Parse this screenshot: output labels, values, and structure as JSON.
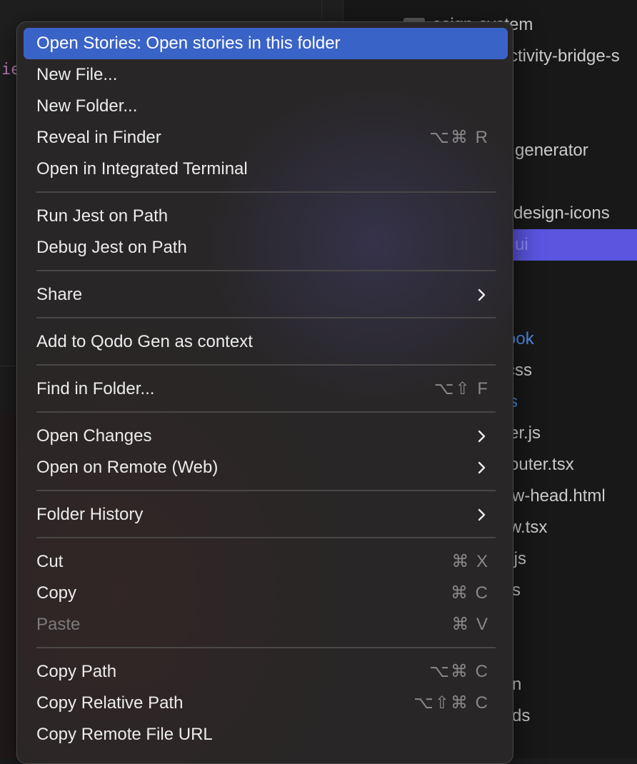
{
  "editor": {
    "code_fragment": "ie"
  },
  "explorer": {
    "rows": [
      {
        "text": "esign-system",
        "state": "normal"
      },
      {
        "text": "ctivity-bridge-s",
        "state": "normal"
      },
      {
        "text": "generator",
        "state": "normal"
      },
      {
        "text": "design-icons",
        "state": "normal"
      },
      {
        "text": "ui",
        "state": "selected"
      },
      {
        "text": "ook",
        "state": "link"
      },
      {
        "text": "css",
        "state": "normal"
      },
      {
        "text": "s",
        "state": "link"
      },
      {
        "text": "er.js",
        "state": "normal"
      },
      {
        "text": "outer.tsx",
        "state": "normal"
      },
      {
        "text": "w-head.html",
        "state": "normal"
      },
      {
        "text": "w.tsx",
        "state": "normal"
      },
      {
        "text": ".js",
        "state": "normal"
      },
      {
        "text": "s",
        "state": "normal"
      },
      {
        "text": "n",
        "state": "normal"
      },
      {
        "text": "ds",
        "state": "normal"
      }
    ]
  },
  "context_menu": {
    "items": [
      {
        "label": "Open Stories: Open stories in this folder",
        "shortcut": "",
        "submenu": false,
        "state": "highlighted"
      },
      {
        "label": "New File...",
        "shortcut": "",
        "submenu": false,
        "state": "normal"
      },
      {
        "label": "New Folder...",
        "shortcut": "",
        "submenu": false,
        "state": "normal"
      },
      {
        "label": "Reveal in Finder",
        "shortcut": "⌥⌘ R",
        "submenu": false,
        "state": "normal"
      },
      {
        "label": "Open in Integrated Terminal",
        "shortcut": "",
        "submenu": false,
        "state": "normal"
      },
      {
        "label": "Run Jest on Path",
        "shortcut": "",
        "submenu": false,
        "state": "normal"
      },
      {
        "label": "Debug Jest on Path",
        "shortcut": "",
        "submenu": false,
        "state": "normal"
      },
      {
        "label": "Share",
        "shortcut": "",
        "submenu": true,
        "state": "normal"
      },
      {
        "label": "Add to Qodo Gen as context",
        "shortcut": "",
        "submenu": false,
        "state": "normal"
      },
      {
        "label": "Find in Folder...",
        "shortcut": "⌥⇧ F",
        "submenu": false,
        "state": "normal"
      },
      {
        "label": "Open Changes",
        "shortcut": "",
        "submenu": true,
        "state": "normal"
      },
      {
        "label": "Open on Remote (Web)",
        "shortcut": "",
        "submenu": true,
        "state": "normal"
      },
      {
        "label": "Folder History",
        "shortcut": "",
        "submenu": true,
        "state": "normal"
      },
      {
        "label": "Cut",
        "shortcut": "⌘ X",
        "submenu": false,
        "state": "normal"
      },
      {
        "label": "Copy",
        "shortcut": "⌘ C",
        "submenu": false,
        "state": "normal"
      },
      {
        "label": "Paste",
        "shortcut": "⌘ V",
        "submenu": false,
        "state": "disabled"
      },
      {
        "label": "Copy Path",
        "shortcut": "⌥⌘ C",
        "submenu": false,
        "state": "normal"
      },
      {
        "label": "Copy Relative Path",
        "shortcut": "⌥⇧⌘ C",
        "submenu": false,
        "state": "normal"
      },
      {
        "label": "Copy Remote File URL",
        "shortcut": "",
        "submenu": false,
        "state": "normal"
      }
    ]
  }
}
